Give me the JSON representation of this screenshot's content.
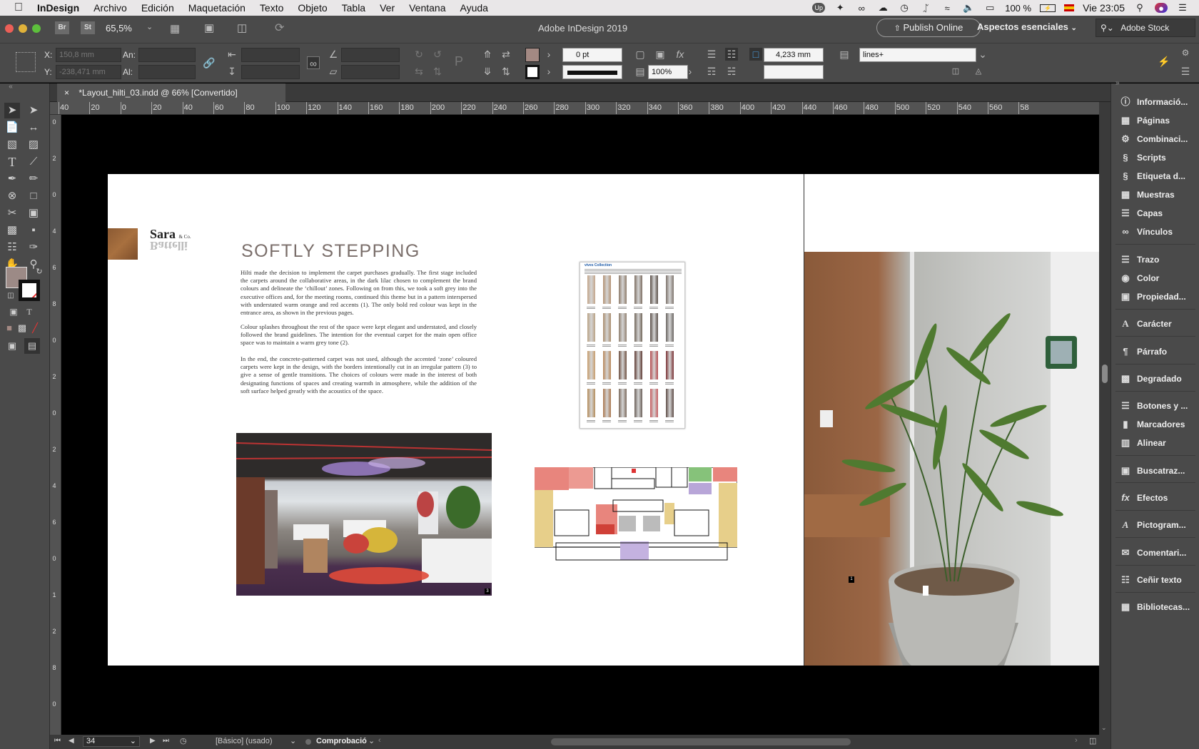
{
  "menubar": {
    "apple": "",
    "app": "InDesign",
    "items": [
      "Archivo",
      "Edición",
      "Maquetación",
      "Texto",
      "Objeto",
      "Tabla",
      "Ver",
      "Ventana",
      "Ayuda"
    ],
    "battery": "100 %",
    "clock": "Vie 23:05"
  },
  "appbar": {
    "badge_br": "Br",
    "badge_st": "St",
    "zoom": "65,5%",
    "title": "Adobe InDesign 2019",
    "publish": "Publish Online",
    "workspace": "Aspectos esenciales",
    "search": "Adobe Stock"
  },
  "control": {
    "x_label": "X:",
    "x_value": "150,8 mm",
    "y_label": "Y:",
    "y_value": "-238,471 mm",
    "w_label": "An:",
    "h_label": "Al:",
    "stroke_pt": "0 pt",
    "scale": "100%",
    "gap": "4,233 mm",
    "style": "lines+"
  },
  "tab": {
    "close": "×",
    "title": "*Layout_hilti_03.indd @ 66% [Convertido]"
  },
  "ruler_h": [
    "40",
    "20",
    "0",
    "20",
    "40",
    "60",
    "80",
    "100",
    "120",
    "140",
    "160",
    "180",
    "200",
    "220",
    "240",
    "260",
    "280",
    "300",
    "320",
    "340",
    "360",
    "380",
    "400",
    "420",
    "440",
    "460",
    "480",
    "500",
    "520",
    "540",
    "560",
    "58"
  ],
  "ruler_v": [
    "0",
    "2",
    "0",
    "4",
    "6",
    "8",
    "0",
    "2",
    "0",
    "2",
    "4",
    "6",
    "0",
    "1",
    "2",
    "8",
    "0"
  ],
  "page": {
    "logo_name": "Sara",
    "logo_sub": "& Co.",
    "logo_name2": "Battelli",
    "heading": "SOFTLY STEPPING",
    "p1": "Hilti made the decision to implement the carpet purchases gradually. The first stage included the carpets around the collaborative areas, in the dark lilac chosen to complement the brand colours and delineate the ‘chillout’ zones. Following on from this, we took a soft grey into the executive offices and, for the meeting rooms, continued this theme but in a pattern interspersed with understated warm orange and red accents (1). The only bold red colour was kept in the entrance area, as shown in the previous pages.",
    "p2": "Colour splashes throughout the rest of the space were kept elegant and understated, and closely followed the brand guidelines. The intention for the eventual carpet for the main open office space was to maintain a warm grey tone (2).",
    "p3": "In the end, the concrete-patterned carpet was not used, although the accented ‘zone’ coloured carpets were kept in the design, with the borders intentionally cut in an irregular pattern (3) to give a sense of gentle transitions. The choices of colours were made in the interest of both designating functions of spaces and creating warmth in atmosphere, while the addition of the soft surface helped greatly with the acoustics of the space.",
    "swatch_title": "vives Collection",
    "swatch_colors": [
      "#c3a58a",
      "#b39172",
      "#8e7b6a",
      "#7d6e62",
      "#5b5048",
      "#7e746c",
      "#b9a284",
      "#a98c6c",
      "#90806f",
      "#716559",
      "#5b5049",
      "#6a6561",
      "#c79c6b",
      "#b88758",
      "#6e5040",
      "#5e3b33",
      "#b34a4d",
      "#7a3134",
      "#b48c5a",
      "#a9764d",
      "#7b6a5d",
      "#6a5f58",
      "#c45a5e",
      "#5d4c46"
    ],
    "photo_label_1": "3",
    "photo_label_2": "1",
    "page_num": "1"
  },
  "status": {
    "page": "34",
    "master": "[Básico] (usado)",
    "preflight": "Comprobació"
  },
  "panels": [
    "Informació...",
    "Páginas",
    "Combinaci...",
    "Scripts",
    "Etiqueta d...",
    "Muestras",
    "Capas",
    "Vínculos",
    "Trazo",
    "Color",
    "Propiedad...",
    "Carácter",
    "Párrafo",
    "Degradado",
    "Botones y ...",
    "Marcadores",
    "Alinear",
    "Buscatraz...",
    "Efectos",
    "Pictogram...",
    "Comentari...",
    "Ceñir texto",
    "Bibliotecas..."
  ],
  "colors": {
    "accent": "#a38983",
    "fill_swatch": "#9c8a86",
    "heading": "#7a6e6a"
  }
}
